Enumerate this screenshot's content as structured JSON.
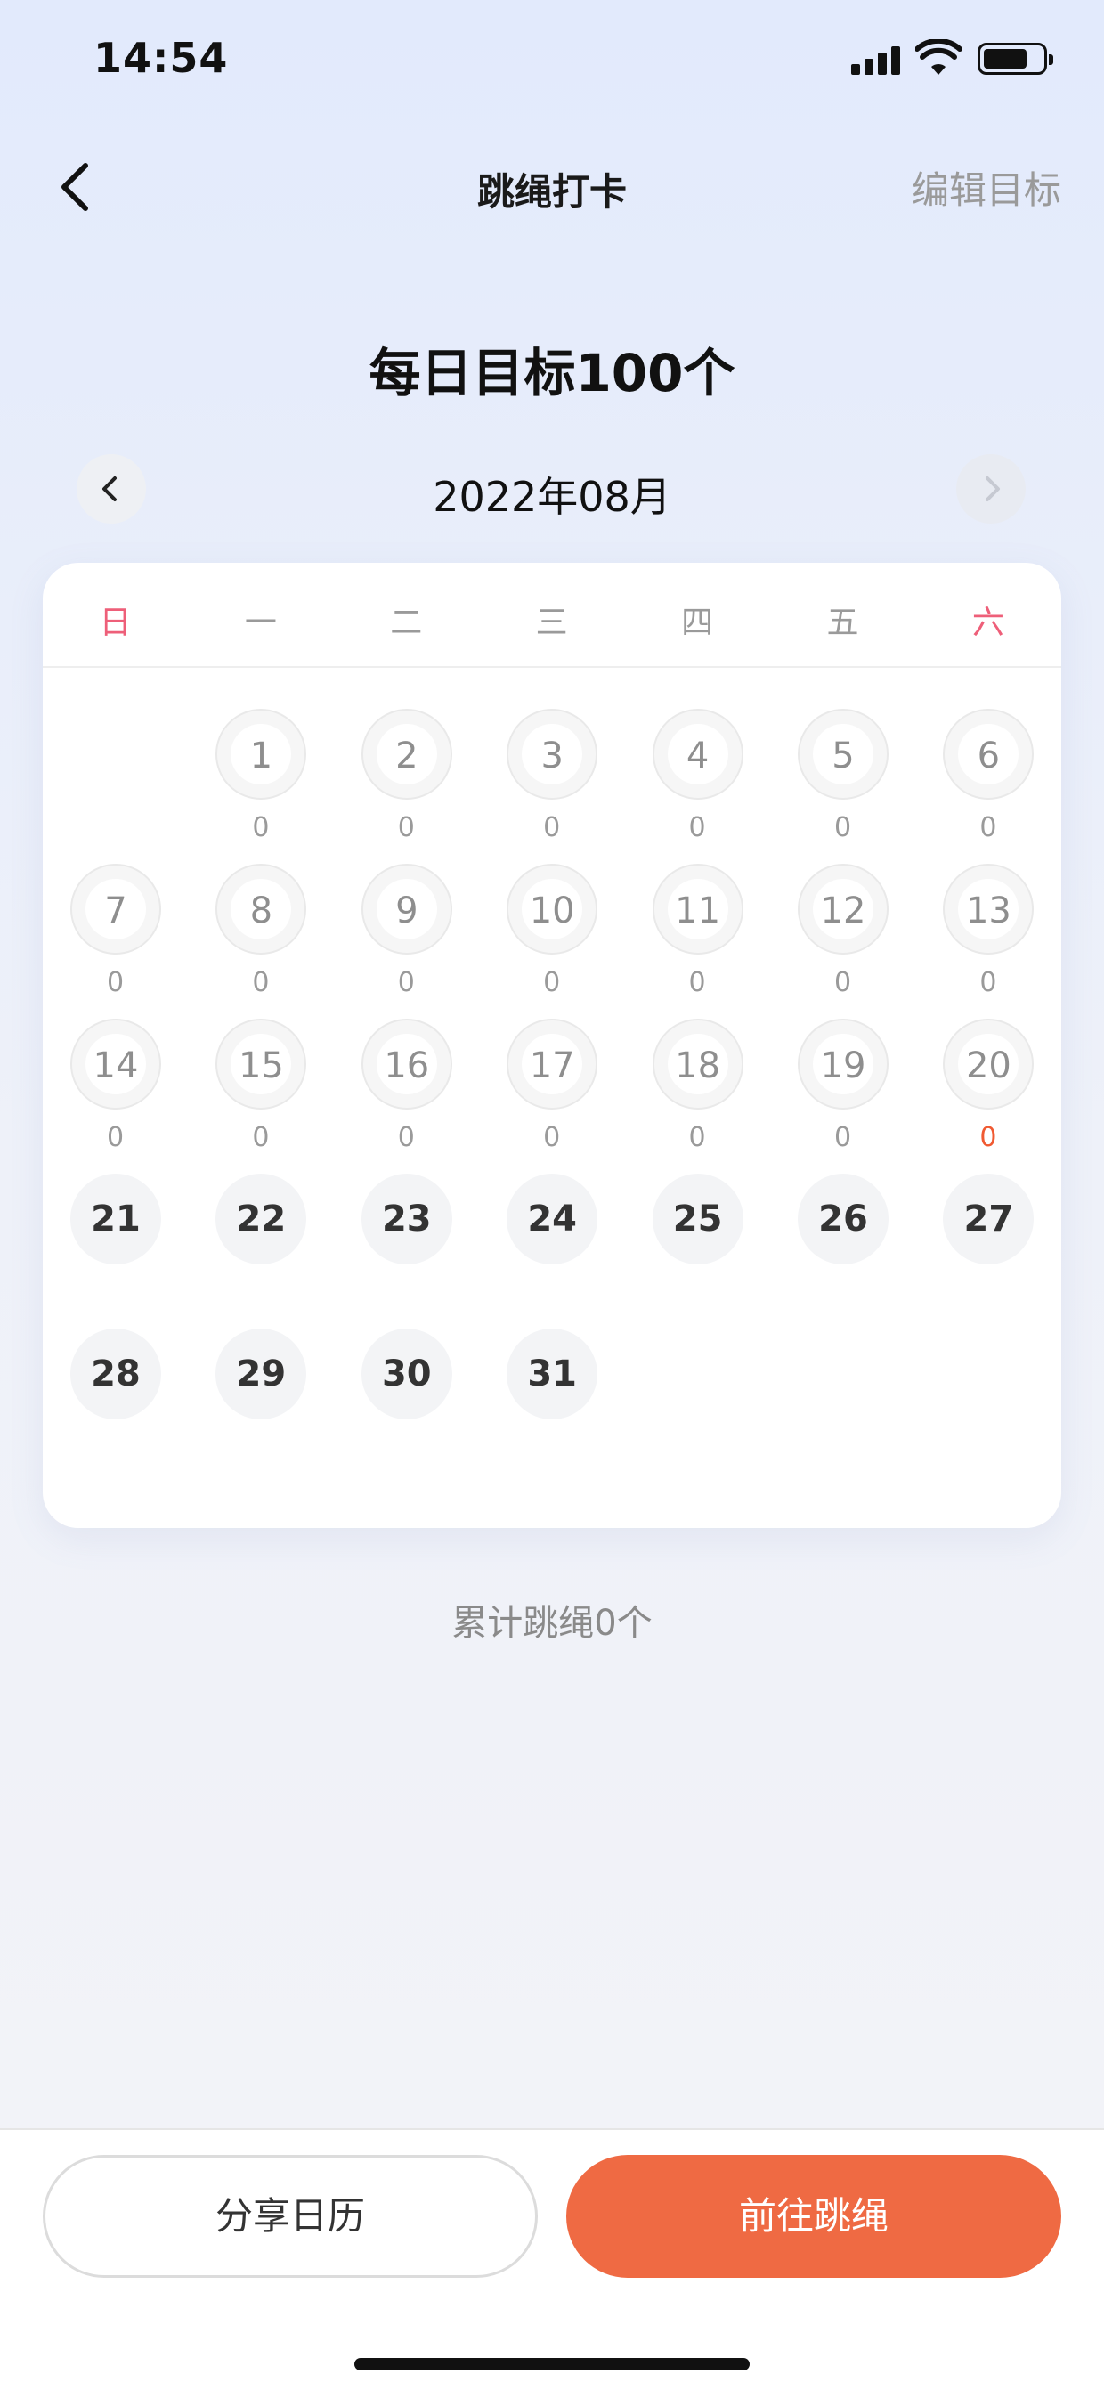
{
  "status": {
    "time": "14:54"
  },
  "nav": {
    "title": "跳绳打卡",
    "edit_label": "编辑目标"
  },
  "goal": {
    "text": "每日目标100个"
  },
  "calendar": {
    "month_label": "2022年08月",
    "weekdays": [
      "日",
      "一",
      "二",
      "三",
      "四",
      "五",
      "六"
    ],
    "first_weekday_index": 1,
    "days": [
      {
        "day": "1",
        "count": "0",
        "state": "past"
      },
      {
        "day": "2",
        "count": "0",
        "state": "past"
      },
      {
        "day": "3",
        "count": "0",
        "state": "past"
      },
      {
        "day": "4",
        "count": "0",
        "state": "past"
      },
      {
        "day": "5",
        "count": "0",
        "state": "past"
      },
      {
        "day": "6",
        "count": "0",
        "state": "past"
      },
      {
        "day": "7",
        "count": "0",
        "state": "past"
      },
      {
        "day": "8",
        "count": "0",
        "state": "past"
      },
      {
        "day": "9",
        "count": "0",
        "state": "past"
      },
      {
        "day": "10",
        "count": "0",
        "state": "past"
      },
      {
        "day": "11",
        "count": "0",
        "state": "past"
      },
      {
        "day": "12",
        "count": "0",
        "state": "past"
      },
      {
        "day": "13",
        "count": "0",
        "state": "past"
      },
      {
        "day": "14",
        "count": "0",
        "state": "past"
      },
      {
        "day": "15",
        "count": "0",
        "state": "past"
      },
      {
        "day": "16",
        "count": "0",
        "state": "past"
      },
      {
        "day": "17",
        "count": "0",
        "state": "past"
      },
      {
        "day": "18",
        "count": "0",
        "state": "past"
      },
      {
        "day": "19",
        "count": "0",
        "state": "past"
      },
      {
        "day": "20",
        "count": "0",
        "state": "today"
      },
      {
        "day": "21",
        "count": "",
        "state": "future"
      },
      {
        "day": "22",
        "count": "",
        "state": "future"
      },
      {
        "day": "23",
        "count": "",
        "state": "future"
      },
      {
        "day": "24",
        "count": "",
        "state": "future"
      },
      {
        "day": "25",
        "count": "",
        "state": "future"
      },
      {
        "day": "26",
        "count": "",
        "state": "future"
      },
      {
        "day": "27",
        "count": "",
        "state": "future"
      },
      {
        "day": "28",
        "count": "",
        "state": "future"
      },
      {
        "day": "29",
        "count": "",
        "state": "future"
      },
      {
        "day": "30",
        "count": "",
        "state": "future"
      },
      {
        "day": "31",
        "count": "",
        "state": "future"
      }
    ]
  },
  "summary": {
    "total_text": "累计跳绳0个"
  },
  "actions": {
    "share_label": "分享日历",
    "go_label": "前往跳绳"
  },
  "colors": {
    "accent": "#ef6a43",
    "today_count": "#f05a32",
    "weekend": "#ee5f79"
  },
  "icons": {
    "back": "chevron-left-icon",
    "prev_month": "chevron-left-icon",
    "next_month": "chevron-right-icon"
  }
}
